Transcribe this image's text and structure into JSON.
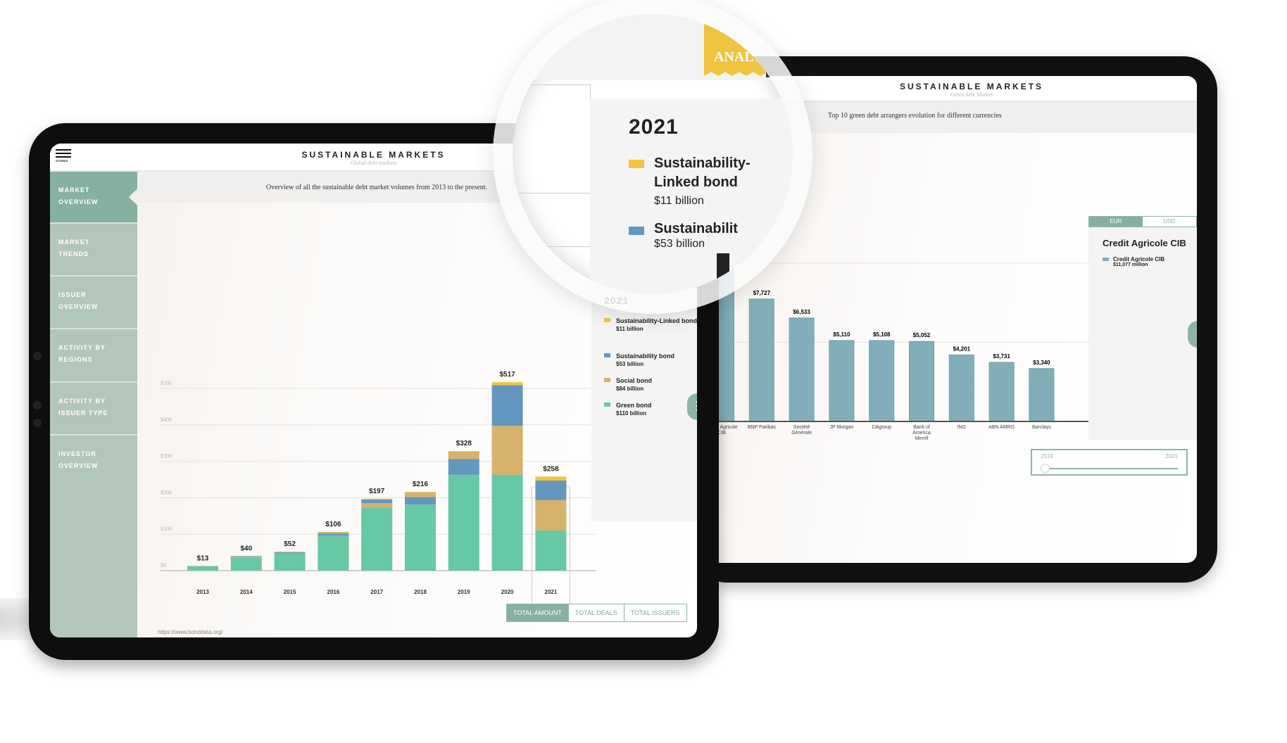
{
  "colors": {
    "green": "#66c8a4",
    "social": "#d6b26a",
    "sustainability": "#6497c0",
    "linked": "#f2c33c",
    "accent": "#86b09f",
    "arranger_bar": "#80afba"
  },
  "left_app": {
    "menu_label": "STORIES",
    "title": "SUSTAINABLE MARKETS",
    "subtitle": "Global debt markets",
    "description": "Overview of all the sustainable debt market volumes from 2013 to the present.",
    "sidebar": [
      {
        "label": "MARKET OVERVIEW",
        "active": true
      },
      {
        "label": "MARKET TRENDS"
      },
      {
        "label": "ISSUER OVERVIEW"
      },
      {
        "label": "ACTIVITY BY REGIONS"
      },
      {
        "label": "ACTIVITY BY ISSUER TYPE"
      },
      {
        "label": "INVESTOR OVERVIEW"
      }
    ],
    "legend": {
      "year": "2021",
      "items": [
        {
          "name": "Sustainability-Linked bond",
          "value": "$11 billion",
          "color": "#f2c33c"
        },
        {
          "name": "Sustainability bond",
          "value": "$53 billion",
          "color": "#6497c0"
        },
        {
          "name": "Social bond",
          "value": "$84 billion",
          "color": "#d6b26a"
        },
        {
          "name": "Green bond",
          "value": "$110 billion",
          "color": "#66c8a4"
        }
      ]
    },
    "buttons": [
      {
        "label": "TOTAL AMOUNT",
        "active": true
      },
      {
        "label": "TOTAL DEALS"
      },
      {
        "label": "TOTAL ISSUERS"
      }
    ],
    "source": "https://www.bonddata.org/"
  },
  "right_app": {
    "title": "SUSTAINABLE MARKETS",
    "subtitle": "Green debt Market",
    "description": "Top 10 green debt arrangers evolution for different currencies",
    "currency_tabs": [
      {
        "label": "EUR",
        "active": true
      },
      {
        "label": "USD"
      }
    ],
    "panel": {
      "title": "Credit Agricole CIB",
      "item_name": "Credit Agricole CIB",
      "item_value": "$11,077 million"
    },
    "slider": {
      "start": "2019",
      "end": "2021",
      "value": "2019"
    }
  },
  "magnifier": {
    "ribbon": "ANALY",
    "year": "2021",
    "items": [
      {
        "name": "Sustainability-Linked bond",
        "value": "$11 billion"
      },
      {
        "name": "Sustainabilit",
        "value": "$53 billion"
      }
    ]
  },
  "chart_data": [
    {
      "type": "bar",
      "stacked": true,
      "categories": [
        "2013",
        "2014",
        "2015",
        "2016",
        "2017",
        "2018",
        "2019",
        "2020",
        "2021"
      ],
      "totals_labels": [
        "$13",
        "$40",
        "$52",
        "$106",
        "$197",
        "$216",
        "$328",
        "$517",
        "$258"
      ],
      "series": [
        {
          "name": "Green bond",
          "color": "#66c8a4",
          "values": [
            12,
            36,
            47,
            96,
            173,
            181,
            263,
            263,
            110
          ]
        },
        {
          "name": "Social bond",
          "color": "#d6b26a",
          "values": [
            1,
            2,
            2,
            4,
            12,
            13,
            21,
            134,
            84
          ]
        },
        {
          "name": "Sustainability bond",
          "color": "#6497c0",
          "values": [
            0,
            2,
            3,
            6,
            10,
            21,
            43,
            112,
            53
          ]
        },
        {
          "name": "Sustainability-Linked bond",
          "color": "#f2c33c",
          "values": [
            0,
            0,
            0,
            0,
            2,
            1,
            1,
            8,
            11
          ]
        }
      ],
      "yticks": [
        "$0",
        "$100",
        "$200",
        "$300",
        "$400",
        "$500"
      ],
      "ylim": [
        0,
        500
      ],
      "grid": true,
      "highlight": "2021"
    },
    {
      "type": "bar",
      "categories": [
        "Credit Agricole CIB",
        "BNP Paribas",
        "Société Générale",
        "JP Morgan",
        "Citigroup",
        "Bank of America Merrill",
        "ING",
        "ABN AMRO",
        "Barclays"
      ],
      "values": [
        11077,
        7727,
        6533,
        5110,
        5108,
        5052,
        4201,
        3731,
        3340
      ],
      "labels": [
        "",
        "$7,727",
        "$6,533",
        "$5,110",
        "$5,108",
        "$5,052",
        "$4,201",
        "$3,731",
        "$3,340"
      ],
      "grid": true,
      "color": "#80afba"
    }
  ]
}
